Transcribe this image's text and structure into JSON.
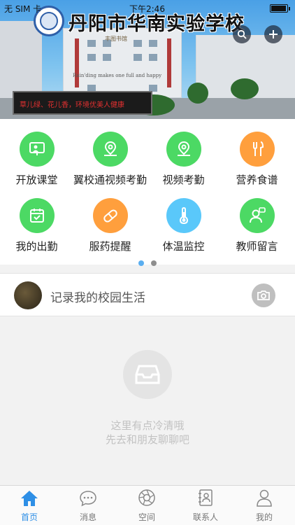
{
  "status_bar": {
    "carrier": "无 SIM 卡",
    "time": "下午2:46"
  },
  "header": {
    "school_name": "丹阳市华南实验学校",
    "banner_slogan": "草儿绿、花儿香，环境优美人健康",
    "building_sign": "Rain'ding makes one full and happy",
    "building_name": "丰图书馆",
    "search_icon": "search-icon",
    "add_icon": "plus-icon"
  },
  "grid": {
    "items": [
      {
        "label": "开放课堂",
        "icon": "classroom-icon",
        "color": "#4cd964"
      },
      {
        "label": "翼校通视频考勤",
        "icon": "location-icon",
        "color": "#4cd964"
      },
      {
        "label": "视频考勤",
        "icon": "location-icon",
        "color": "#4cd964"
      },
      {
        "label": "营养食谱",
        "icon": "utensils-icon",
        "color": "#ff9f3d"
      },
      {
        "label": "我的出勤",
        "icon": "calendar-check-icon",
        "color": "#4cd964"
      },
      {
        "label": "服药提醒",
        "icon": "pill-icon",
        "color": "#ff9f3d"
      },
      {
        "label": "体温监控",
        "icon": "thermometer-icon",
        "color": "#5ac8fa"
      },
      {
        "label": "教师留言",
        "icon": "teacher-message-icon",
        "color": "#4cd964"
      }
    ],
    "page_dots": {
      "active": 0,
      "count": 2,
      "active_color": "#5aaef0",
      "inactive_color": "#8e8e8e"
    }
  },
  "post": {
    "placeholder": "记录我的校园生活",
    "camera_icon": "camera-icon"
  },
  "empty": {
    "line1": "这里有点冷清哦",
    "line2": "先去和朋友聊聊吧",
    "icon": "inbox-icon"
  },
  "tabbar": {
    "items": [
      {
        "label": "首页",
        "icon": "home-icon",
        "active": true
      },
      {
        "label": "消息",
        "icon": "chat-bubble-icon",
        "active": false
      },
      {
        "label": "空间",
        "icon": "aperture-icon",
        "active": false
      },
      {
        "label": "联系人",
        "icon": "contacts-book-icon",
        "active": false
      },
      {
        "label": "我的",
        "icon": "person-icon",
        "active": false
      }
    ],
    "active_color": "#2e8fe6"
  }
}
